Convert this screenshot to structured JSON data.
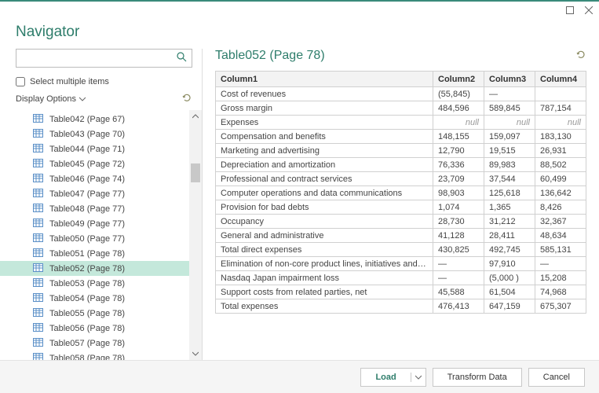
{
  "window": {
    "title": "Navigator"
  },
  "search": {
    "placeholder": ""
  },
  "checkbox_label": "Select multiple items",
  "display_options_label": "Display Options",
  "tree_items": [
    {
      "label": "Table042 (Page 67)"
    },
    {
      "label": "Table043 (Page 70)"
    },
    {
      "label": "Table044 (Page 71)"
    },
    {
      "label": "Table045 (Page 72)"
    },
    {
      "label": "Table046 (Page 74)"
    },
    {
      "label": "Table047 (Page 77)"
    },
    {
      "label": "Table048 (Page 77)"
    },
    {
      "label": "Table049 (Page 77)"
    },
    {
      "label": "Table050 (Page 77)"
    },
    {
      "label": "Table051 (Page 78)"
    },
    {
      "label": "Table052 (Page 78)",
      "selected": true
    },
    {
      "label": "Table053 (Page 78)"
    },
    {
      "label": "Table054 (Page 78)"
    },
    {
      "label": "Table055 (Page 78)"
    },
    {
      "label": "Table056 (Page 78)"
    },
    {
      "label": "Table057 (Page 78)"
    },
    {
      "label": "Table058 (Page 78)"
    }
  ],
  "preview": {
    "title": "Table052 (Page 78)",
    "columns": [
      "Column1",
      "Column2",
      "Column3",
      "Column4"
    ],
    "rows": [
      [
        "Cost of revenues",
        "(55,845)",
        "—",
        ""
      ],
      [
        "Gross margin",
        "484,596",
        "589,845",
        "787,154"
      ],
      [
        "Expenses",
        "null",
        "null",
        "null"
      ],
      [
        "Compensation and benefits",
        "148,155",
        "159,097",
        "183,130"
      ],
      [
        "Marketing and advertising",
        "12,790",
        "19,515",
        "26,931"
      ],
      [
        "Depreciation and amortization",
        "76,336",
        "89,983",
        "88,502"
      ],
      [
        "Professional and contract services",
        "23,709",
        "37,544",
        "60,499"
      ],
      [
        "Computer operations and data communications",
        "98,903",
        "125,618",
        "136,642"
      ],
      [
        "Provision for bad debts",
        "1,074",
        "1,365",
        "8,426"
      ],
      [
        "Occupancy",
        "28,730",
        "31,212",
        "32,367"
      ],
      [
        "General and administrative",
        "41,128",
        "28,411",
        "48,634"
      ],
      [
        "Total direct expenses",
        "430,825",
        "492,745",
        "585,131"
      ],
      [
        "Elimination of non-core product lines, initiatives and severance",
        "—",
        "97,910",
        "—"
      ],
      [
        "Nasdaq Japan impairment loss",
        "—",
        "(5,000 )",
        "15,208"
      ],
      [
        "Support costs from related parties, net",
        "45,588",
        "61,504",
        "74,968"
      ],
      [
        "Total expenses",
        "476,413",
        "647,159",
        "675,307"
      ]
    ]
  },
  "footer": {
    "load": "Load",
    "transform": "Transform Data",
    "cancel": "Cancel"
  },
  "chart_data": {
    "type": "table",
    "title": "Table052 (Page 78)",
    "columns": [
      "Column1",
      "Column2",
      "Column3",
      "Column4"
    ],
    "rows": [
      [
        "Cost of revenues",
        -55845,
        null,
        null
      ],
      [
        "Gross margin",
        484596,
        589845,
        787154
      ],
      [
        "Expenses",
        null,
        null,
        null
      ],
      [
        "Compensation and benefits",
        148155,
        159097,
        183130
      ],
      [
        "Marketing and advertising",
        12790,
        19515,
        26931
      ],
      [
        "Depreciation and amortization",
        76336,
        89983,
        88502
      ],
      [
        "Professional and contract services",
        23709,
        37544,
        60499
      ],
      [
        "Computer operations and data communications",
        98903,
        125618,
        136642
      ],
      [
        "Provision for bad debts",
        1074,
        1365,
        8426
      ],
      [
        "Occupancy",
        28730,
        31212,
        32367
      ],
      [
        "General and administrative",
        41128,
        28411,
        48634
      ],
      [
        "Total direct expenses",
        430825,
        492745,
        585131
      ],
      [
        "Elimination of non-core product lines, initiatives and severance",
        null,
        97910,
        null
      ],
      [
        "Nasdaq Japan impairment loss",
        null,
        -5000,
        15208
      ],
      [
        "Support costs from related parties, net",
        45588,
        61504,
        74968
      ],
      [
        "Total expenses",
        476413,
        647159,
        675307
      ]
    ]
  }
}
